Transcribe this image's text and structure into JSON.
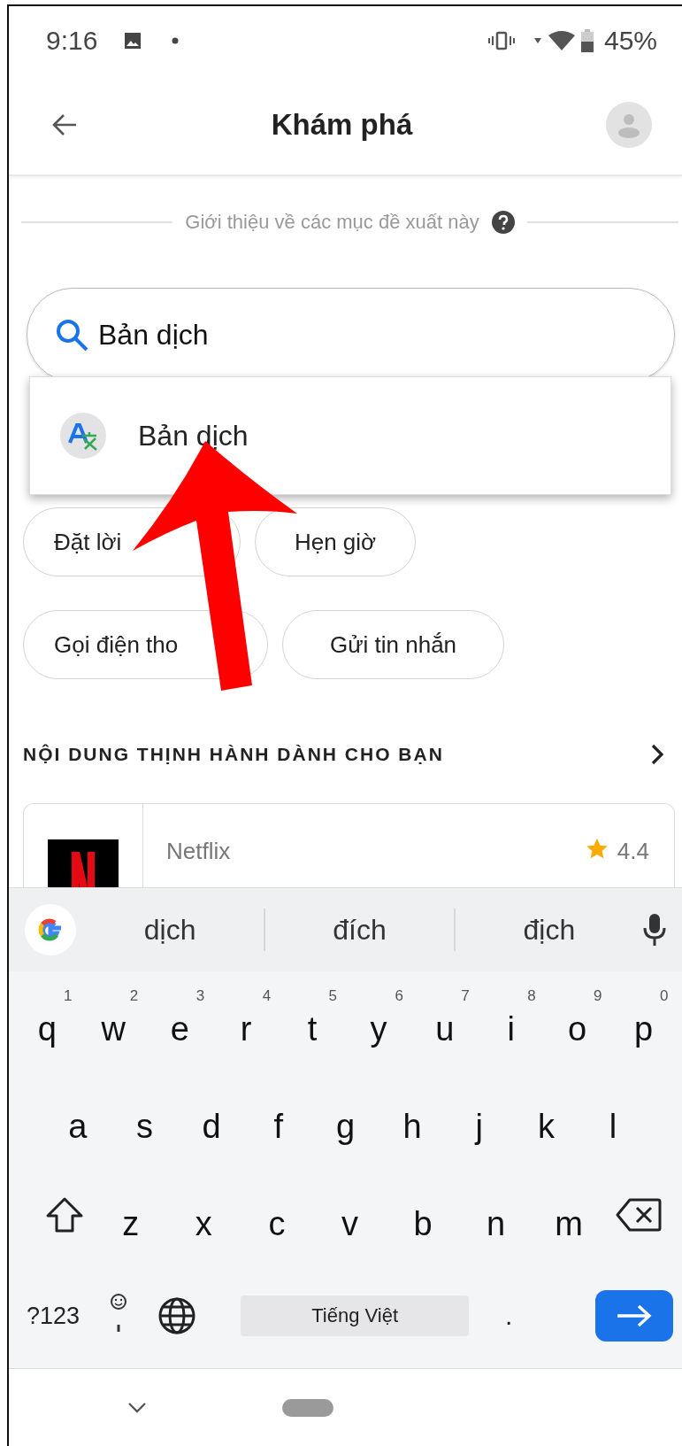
{
  "status_bar": {
    "time": "9:16",
    "battery": "45%"
  },
  "app_bar": {
    "title": "Khám phá"
  },
  "intro": {
    "text": "Giới thiệu về các mục đề xuất này"
  },
  "search": {
    "value": "Bản dịch"
  },
  "dropdown": {
    "items": [
      {
        "label": "Bản dịch"
      }
    ]
  },
  "chips": [
    {
      "label": "Đặt lời"
    },
    {
      "label": "Hẹn giờ"
    },
    {
      "label": "Gọi điện tho"
    },
    {
      "label": "Gửi tin nhắn"
    }
  ],
  "section": {
    "title": "NỘI DUNG THỊNH HÀNH DÀNH CHO BẠN"
  },
  "card": {
    "name": "Netflix",
    "rating": "4.4"
  },
  "keyboard": {
    "suggestions": [
      "dịch",
      "đích",
      "địch"
    ],
    "rows": [
      [
        {
          "kind": "letter",
          "key": "q",
          "hint": "1"
        },
        {
          "kind": "letter",
          "key": "w",
          "hint": "2"
        },
        {
          "kind": "letter",
          "key": "e",
          "hint": "3"
        },
        {
          "kind": "letter",
          "key": "r",
          "hint": "4"
        },
        {
          "kind": "letter",
          "key": "t",
          "hint": "5"
        },
        {
          "kind": "letter",
          "key": "y",
          "hint": "6"
        },
        {
          "kind": "letter",
          "key": "u",
          "hint": "7"
        },
        {
          "kind": "letter",
          "key": "i",
          "hint": "8"
        },
        {
          "kind": "letter",
          "key": "o",
          "hint": "9"
        },
        {
          "kind": "letter",
          "key": "p",
          "hint": "0"
        }
      ],
      [
        {
          "kind": "letter",
          "key": "a"
        },
        {
          "kind": "letter",
          "key": "s"
        },
        {
          "kind": "letter",
          "key": "d"
        },
        {
          "kind": "letter",
          "key": "f"
        },
        {
          "kind": "letter",
          "key": "g"
        },
        {
          "kind": "letter",
          "key": "h"
        },
        {
          "kind": "letter",
          "key": "j"
        },
        {
          "kind": "letter",
          "key": "k"
        },
        {
          "kind": "letter",
          "key": "l"
        }
      ],
      [
        {
          "kind": "shift"
        },
        {
          "kind": "letter",
          "key": "z"
        },
        {
          "kind": "letter",
          "key": "x"
        },
        {
          "kind": "letter",
          "key": "c"
        },
        {
          "kind": "letter",
          "key": "v"
        },
        {
          "kind": "letter",
          "key": "b"
        },
        {
          "kind": "letter",
          "key": "n"
        },
        {
          "kind": "letter",
          "key": "m"
        },
        {
          "kind": "backspace"
        }
      ]
    ],
    "symbols_key": "?123",
    "space_label": "Tiếng Việt",
    "period_key": "."
  }
}
